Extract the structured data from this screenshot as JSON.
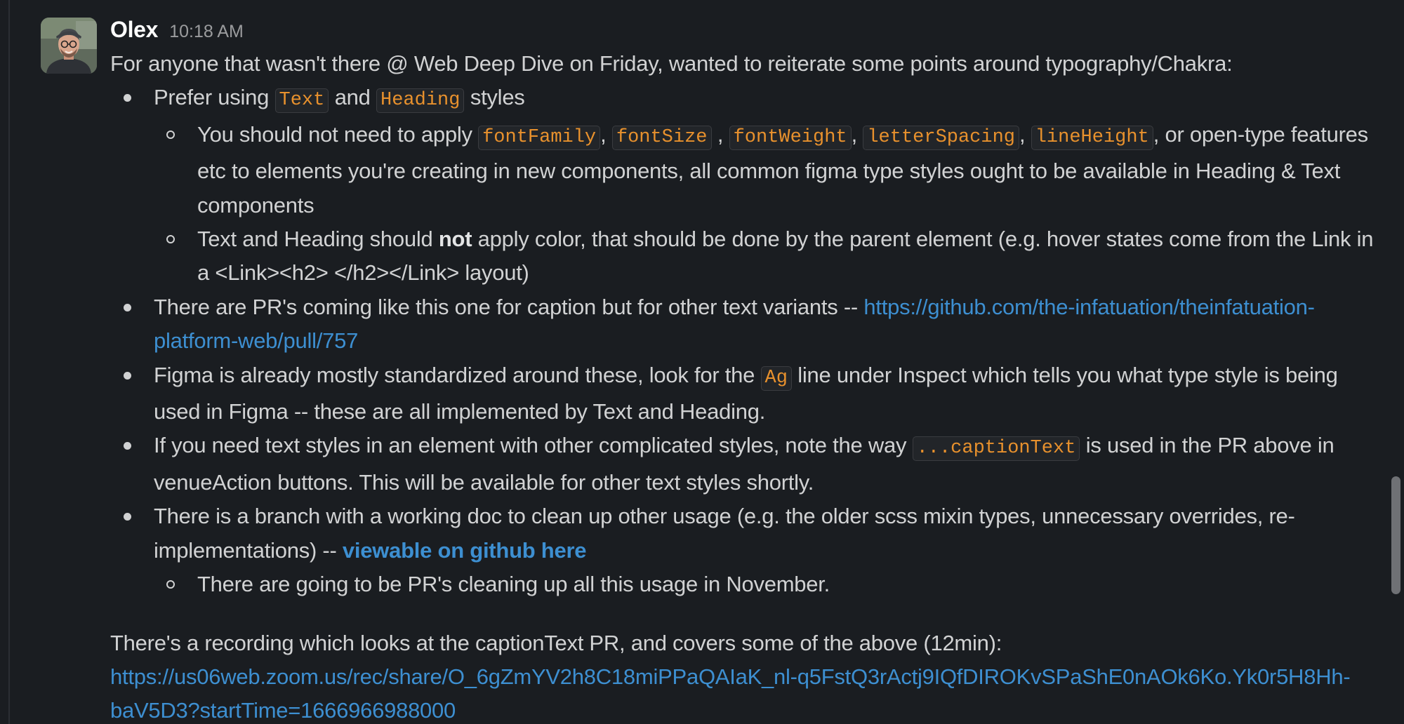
{
  "message": {
    "author": "Olex",
    "timestamp": "10:18 AM",
    "intro": "For anyone that wasn't there @ Web Deep Dive on Friday, wanted to reiterate some points around typography/Chakra:",
    "bullet1": {
      "prefix": "Prefer using ",
      "code1": "Text",
      "mid": " and ",
      "code2": "Heading",
      "suffix": " styles",
      "sub1": {
        "prefix": "You should not need to apply ",
        "code1": "fontFamily",
        "sep1": ", ",
        "code2": "fontSize",
        "sep2": " , ",
        "code3": "fontWeight",
        "sep3": ", ",
        "code4": "letterSpacing",
        "sep4": ", ",
        "code5": "lineHeight",
        "suffix": ", or open-type features etc to elements you're creating in new components, all common figma type styles ought to be available in Heading & Text components"
      },
      "sub2": {
        "prefix": "Text and Heading should ",
        "bold": "not",
        "suffix": " apply color, that should be done by the parent element (e.g. hover states come from the Link in a <Link><h2> </h2></Link> layout)"
      }
    },
    "bullet2": {
      "text": "There are PR's coming like this one for caption but for other text variants --  ",
      "link": "https://github.com/the-infatuation/theinfatuation-platform-web/pull/757"
    },
    "bullet3": {
      "prefix": "Figma is already mostly standardized around these, look for the ",
      "code": "Ag",
      "suffix": " line under Inspect which tells you what type style is being used in Figma -- these are all implemented by Text and Heading."
    },
    "bullet4": {
      "prefix": "If you need text styles in an element with other complicated styles, note the way ",
      "code": "...captionText",
      "suffix": " is used in the PR above in venueAction buttons. This will be available for other text styles shortly."
    },
    "bullet5": {
      "prefix": "There is a branch with a working doc to clean up other usage (e.g. the older scss mixin types, unnecessary overrides, re-implementations) -- ",
      "link": "viewable on github here",
      "sub1": "There are going to be PR's cleaning up all this usage in November."
    },
    "outro": {
      "text": "There's a recording which looks at the captionText PR, and covers some of the above (12min):",
      "link": "https://us06web.zoom.us/rec/share/O_6gZmYV2h8C18miPPaQAIaK_nl-q5FstQ3rActj9IQfDIROKvSPaShE0nAOk6Ko.Yk0r5H8Hh-baV5D3?startTime=1666966988000"
    }
  },
  "colors": {
    "background": "#1a1d21",
    "text": "#d1d2d3",
    "code": "#e8912d",
    "link": "#3d8fd1"
  },
  "icons": {
    "avatar": "user-avatar-photo"
  }
}
